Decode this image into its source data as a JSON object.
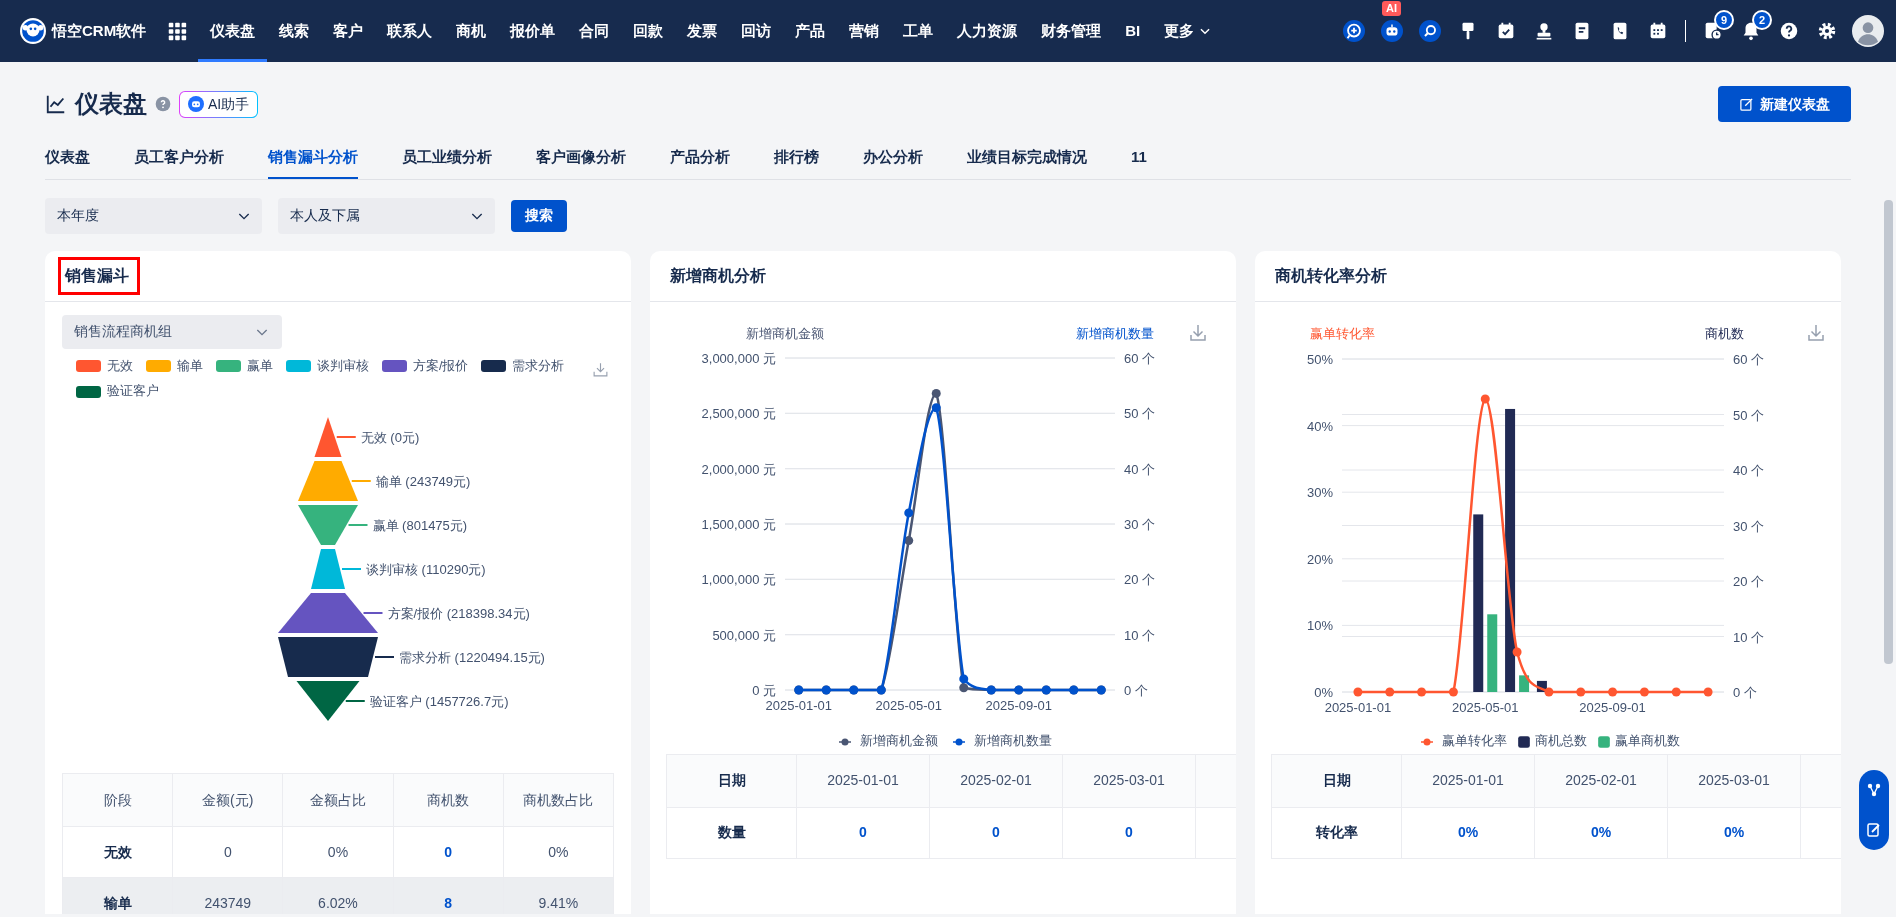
{
  "navbar": {
    "logo_text": "悟空CRM软件",
    "items": [
      {
        "label": "仪表盘",
        "selected": true
      },
      {
        "label": "线索",
        "selected": false
      },
      {
        "label": "客户",
        "selected": false
      },
      {
        "label": "联系人",
        "selected": false
      },
      {
        "label": "商机",
        "selected": false
      },
      {
        "label": "报价单",
        "selected": false
      },
      {
        "label": "合同",
        "selected": false
      },
      {
        "label": "回款",
        "selected": false
      },
      {
        "label": "发票",
        "selected": false
      },
      {
        "label": "回访",
        "selected": false
      },
      {
        "label": "产品",
        "selected": false
      },
      {
        "label": "营销",
        "selected": false
      },
      {
        "label": "工单",
        "selected": false
      },
      {
        "label": "人力资源",
        "selected": false
      },
      {
        "label": "财务管理",
        "selected": false
      },
      {
        "label": "BI",
        "selected": false
      }
    ],
    "more_label": "更多",
    "ai_badge": "AI",
    "task_badge": "9",
    "notification_badge": "2"
  },
  "header": {
    "title": "仪表盘",
    "ai_button": "AI助手",
    "new_button": "新建仪表盘"
  },
  "tabs": [
    {
      "label": "仪表盘",
      "selected": false
    },
    {
      "label": "员工客户分析",
      "selected": false
    },
    {
      "label": "销售漏斗分析",
      "selected": true
    },
    {
      "label": "员工业绩分析",
      "selected": false
    },
    {
      "label": "客户画像分析",
      "selected": false
    },
    {
      "label": "产品分析",
      "selected": false
    },
    {
      "label": "排行榜",
      "selected": false
    },
    {
      "label": "办公分析",
      "selected": false
    },
    {
      "label": "业绩目标完成情况",
      "selected": false
    },
    {
      "label": "11",
      "selected": false
    }
  ],
  "filters": {
    "period": "本年度",
    "scope": "本人及下属",
    "search_button": "搜索"
  },
  "funnel_card": {
    "title": "销售漏斗",
    "highlighted": true,
    "group_select": "销售流程商机组",
    "legend": [
      {
        "name": "无效",
        "color": "#ff5630"
      },
      {
        "name": "输单",
        "color": "#ffab00"
      },
      {
        "name": "赢单",
        "color": "#36b37e"
      },
      {
        "name": "谈判审核",
        "color": "#00b8d9"
      },
      {
        "name": "方案/报价",
        "color": "#6554c0"
      },
      {
        "name": "需求分析",
        "color": "#172b4d"
      },
      {
        "name": "验证客户",
        "color": "#006644"
      }
    ],
    "stages": [
      {
        "label": "无效 (0元)",
        "color": "#ff5630"
      },
      {
        "label": "输单 (243749元)",
        "color": "#ffab00"
      },
      {
        "label": "赢单 (801475元)",
        "color": "#36b37e"
      },
      {
        "label": "谈判审核 (110290元)",
        "color": "#00b8d9"
      },
      {
        "label": "方案/报价 (218398.34元)",
        "color": "#6554c0"
      },
      {
        "label": "需求分析 (1220494.15元)",
        "color": "#172b4d"
      },
      {
        "label": "验证客户 (1457726.7元)",
        "color": "#006644"
      }
    ],
    "table": {
      "columns": [
        {
          "label": "阶段",
          "kind": "head"
        },
        {
          "label": "金额(元)",
          "kind": "text"
        },
        {
          "label": "金额占比",
          "kind": "text"
        },
        {
          "label": "商机数",
          "kind": "link"
        },
        {
          "label": "商机数占比",
          "kind": "text"
        }
      ],
      "rows": [
        {
          "shaded": false,
          "cells": [
            "无效",
            "0",
            "0%",
            "0",
            "0%"
          ]
        },
        {
          "shaded": true,
          "cells": [
            "输单",
            "243749",
            "6.02%",
            "8",
            "9.41%"
          ]
        }
      ]
    }
  },
  "new_opportunity_card": {
    "title": "新增商机分析",
    "chart_data": {
      "type": "line",
      "ylabel": "新增商机金额",
      "y2label": "新增商机数量",
      "grid": true,
      "categories": [
        "2025-01-01",
        null,
        null,
        null,
        "2025-05-01",
        null,
        null,
        null,
        "2025-09-01",
        null,
        null,
        null
      ],
      "ylim": [
        0,
        3000000
      ],
      "yticks": [
        {
          "value": 0,
          "label": "0 元"
        },
        {
          "value": 500000,
          "label": "500,000 元"
        },
        {
          "value": 1000000,
          "label": "1,000,000 元"
        },
        {
          "value": 1500000,
          "label": "1,500,000 元"
        },
        {
          "value": 2000000,
          "label": "2,000,000 元"
        },
        {
          "value": 2500000,
          "label": "2,500,000 元"
        },
        {
          "value": 3000000,
          "label": "3,000,000 元"
        }
      ],
      "y2lim": [
        0,
        60
      ],
      "y2ticks": [
        {
          "value": 0,
          "label": "0 个"
        },
        {
          "value": 10,
          "label": "10 个"
        },
        {
          "value": 20,
          "label": "20 个"
        },
        {
          "value": 30,
          "label": "30 个"
        },
        {
          "value": 40,
          "label": "40 个"
        },
        {
          "value": 50,
          "label": "50 个"
        },
        {
          "value": 60,
          "label": "60 个"
        }
      ],
      "series": [
        {
          "name": "新增商机金额",
          "color": "#4a5673",
          "marker": "circle",
          "values": [
            0,
            0,
            0,
            0,
            1350000,
            2680000,
            20000,
            0,
            0,
            0,
            0,
            0
          ]
        },
        {
          "name": "新增商机数量",
          "color": "#0052cc",
          "axis": "y2",
          "marker": "circle",
          "values": [
            0,
            0,
            0,
            0,
            32,
            51,
            2,
            0,
            0,
            0,
            0,
            0
          ]
        }
      ]
    },
    "table": {
      "columns": [
        "日期",
        "2025-01-01",
        "2025-02-01",
        "2025-03-01"
      ],
      "rows": [
        {
          "label": "数量",
          "values": [
            "0",
            "0",
            "0"
          ]
        }
      ]
    }
  },
  "conversion_card": {
    "title": "商机转化率分析",
    "chart_data": {
      "type": "bar",
      "ylabel": "赢单转化率",
      "y2label": "商机数",
      "grid": true,
      "categories": [
        "2025-01-01",
        null,
        null,
        null,
        "2025-05-01",
        null,
        null,
        null,
        "2025-09-01",
        null,
        null,
        null
      ],
      "ylim": [
        0,
        50
      ],
      "yticks": [
        {
          "value": 0,
          "label": "0%"
        },
        {
          "value": 10,
          "label": "10%"
        },
        {
          "value": 20,
          "label": "20%"
        },
        {
          "value": 30,
          "label": "30%"
        },
        {
          "value": 40,
          "label": "40%"
        },
        {
          "value": 50,
          "label": "50%"
        }
      ],
      "y2lim": [
        0,
        60
      ],
      "y2ticks": [
        {
          "value": 0,
          "label": "0 个"
        },
        {
          "value": 10,
          "label": "10 个"
        },
        {
          "value": 20,
          "label": "20 个"
        },
        {
          "value": 30,
          "label": "30 个"
        },
        {
          "value": 40,
          "label": "40 个"
        },
        {
          "value": 50,
          "label": "50 个"
        },
        {
          "value": 60,
          "label": "60 个"
        }
      ],
      "series": [
        {
          "name": "赢单转化率",
          "color": "#ff5630",
          "type": "line",
          "marker": "circle",
          "values": [
            0,
            0,
            0,
            0,
            44,
            6,
            0,
            0,
            0,
            0,
            0,
            0
          ]
        },
        {
          "name": "商机总数",
          "color": "#212a54",
          "axis": "y2",
          "values": [
            0,
            0,
            0,
            0,
            32,
            51,
            2,
            0,
            0,
            0,
            0,
            0
          ]
        },
        {
          "name": "赢单商机数",
          "color": "#36b37e",
          "axis": "y2",
          "values": [
            0,
            0,
            0,
            0,
            14,
            3,
            0,
            0,
            0,
            0,
            0,
            0
          ]
        }
      ]
    },
    "table": {
      "columns": [
        "日期",
        "2025-01-01",
        "2025-02-01",
        "2025-03-01"
      ],
      "rows": [
        {
          "label": "转化率",
          "values": [
            "0%",
            "0%",
            "0%"
          ]
        }
      ]
    }
  }
}
